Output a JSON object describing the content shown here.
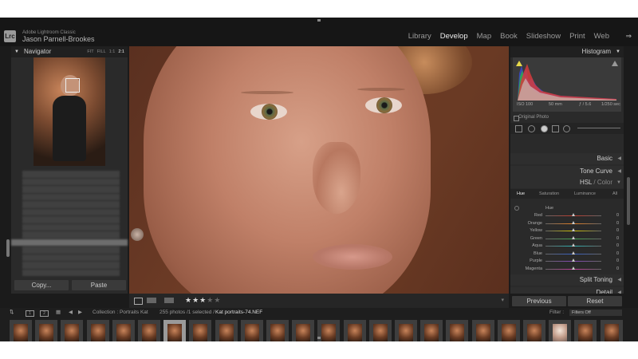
{
  "app": {
    "logo": "Lrc",
    "product": "Adobe Lightroom Classic",
    "user": "Jason Parnell-Brookes"
  },
  "modules": [
    {
      "label": "Library",
      "active": false
    },
    {
      "label": "Develop",
      "active": true
    },
    {
      "label": "Map",
      "active": false
    },
    {
      "label": "Book",
      "active": false
    },
    {
      "label": "Slideshow",
      "active": false
    },
    {
      "label": "Print",
      "active": false
    },
    {
      "label": "Web",
      "active": false
    }
  ],
  "navigator": {
    "title": "Navigator",
    "zoom_options": [
      "FIT",
      "FILL",
      "1:1",
      "2:1"
    ],
    "active_zoom": "2:1"
  },
  "left_buttons": {
    "copy": "Copy...",
    "paste": "Paste"
  },
  "toolbar": {
    "rating": 3,
    "rating_max": 5
  },
  "histogram": {
    "title": "Histogram",
    "iso": "ISO 100",
    "focal": "50 mm",
    "aperture": "ƒ / 5.6",
    "shutter": "1/250 sec",
    "original": "Original Photo"
  },
  "panels": {
    "basic": "Basic",
    "tone_curve": "Tone Curve",
    "hsl_title": "HSL",
    "hsl_sep": " / ",
    "color_title": "Color",
    "split_toning": "Split Toning",
    "detail": "Detail"
  },
  "hsl_tabs": [
    "Hue",
    "Saturation",
    "Luminance",
    "All"
  ],
  "hsl_active_tab": "Hue",
  "hue_section_label": "Hue",
  "hue_sliders": [
    {
      "name": "Red",
      "value": "0",
      "color": "#c0392b"
    },
    {
      "name": "Orange",
      "value": "0",
      "color": "#e67e22"
    },
    {
      "name": "Yellow",
      "value": "0",
      "color": "#d4c400"
    },
    {
      "name": "Green",
      "value": "0",
      "color": "#3fa34d"
    },
    {
      "name": "Aqua",
      "value": "0",
      "color": "#2ab3b3"
    },
    {
      "name": "Blue",
      "value": "0",
      "color": "#3560c8"
    },
    {
      "name": "Purple",
      "value": "0",
      "color": "#8446b8"
    },
    {
      "name": "Magenta",
      "value": "0",
      "color": "#c23b9a"
    }
  ],
  "right_buttons": {
    "previous": "Previous",
    "reset": "Reset"
  },
  "filmstrip_bar": {
    "page1": "1",
    "page2": "2",
    "collection": "Collection : Portraits Kat",
    "status": "255 photos /1 selected /",
    "filename": "Kat portraits-74.NEF",
    "filter_label": "Filter :",
    "filter_value": "Filters Off"
  },
  "filmstrip": {
    "count": 24,
    "selected_index": 6,
    "light_index": 21
  }
}
